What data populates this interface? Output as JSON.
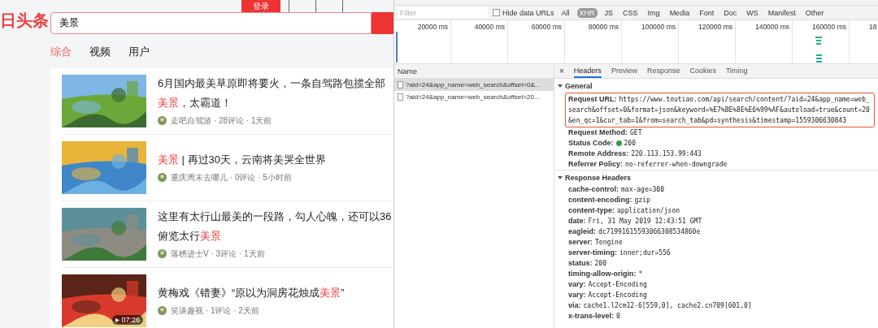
{
  "site": {
    "logo": "日头条",
    "login": "登录",
    "search": {
      "value": "美景"
    },
    "tabs": [
      {
        "label": "综合",
        "selected": true
      },
      {
        "label": "视频",
        "selected": false
      },
      {
        "label": "用户",
        "selected": false
      }
    ],
    "results": [
      {
        "lines": [
          [
            {
              "text": "6月国内最美草原即将要火，一条自驾路包揽全部",
              "highlight": false
            }
          ],
          [
            {
              "text": "美景",
              "highlight": true
            },
            {
              "text": "，太霸道！",
              "highlight": false
            }
          ]
        ],
        "meta": "走吧自驾游 · 28评论 · 1天前",
        "thumb": {
          "kind": "picture"
        }
      },
      {
        "lines": [
          [
            {
              "text": "美景",
              "highlight": true
            },
            {
              "text": " | 再过30天，云南将美哭全世界",
              "highlight": false
            }
          ]
        ],
        "meta": "重庆周末去哪儿 · 0评论 · 5小时前",
        "thumb": {
          "kind": "picture"
        }
      },
      {
        "lines": [
          [
            {
              "text": "这里有太行山最美的一段路，勾人心魄，还可以36",
              "highlight": false
            }
          ],
          [
            {
              "text": "俯览太行",
              "highlight": false
            },
            {
              "text": "美景",
              "highlight": true
            }
          ]
        ],
        "meta": "落榜进士V · 3评论 · 1天前",
        "thumb": {
          "kind": "picture"
        }
      },
      {
        "lines": [
          [
            {
              "text": "黄梅戏《错妻》“原以为洞房花烛成",
              "highlight": false
            },
            {
              "text": "美景",
              "highlight": true
            },
            {
              "text": "”",
              "highlight": false
            }
          ]
        ],
        "meta": "笑谈趣视 · 1评论 · 2天前",
        "thumb": {
          "kind": "picture"
        },
        "duration": "07:26"
      }
    ]
  },
  "devtools": {
    "filter": {
      "placeholder": "Filter"
    },
    "hide_data_urls": {
      "label": "Hide data URLs",
      "checked": false
    },
    "types": [
      {
        "label": "All",
        "selected": false
      },
      {
        "label": "XHR",
        "selected": true
      },
      {
        "label": "JS",
        "selected": false
      },
      {
        "label": "CSS",
        "selected": false
      },
      {
        "label": "Img",
        "selected": false
      },
      {
        "label": "Media",
        "selected": false
      },
      {
        "label": "Font",
        "selected": false
      },
      {
        "label": "Doc",
        "selected": false
      },
      {
        "label": "WS",
        "selected": false
      },
      {
        "label": "Manifest",
        "selected": false
      },
      {
        "label": "Other",
        "selected": false
      }
    ],
    "timeline_ticks": [
      "20000 ms",
      "40000 ms",
      "60000 ms",
      "80000 ms",
      "100000 ms",
      "120000 ms",
      "140000 ms",
      "160000 ms",
      "18"
    ],
    "name_header": "Name",
    "requests": [
      {
        "name": "?aid=24&app_name=web_search&offset=0&...",
        "selected": true
      },
      {
        "name": "?aid=24&app_name=web_search&offset=20...",
        "selected": false
      }
    ],
    "close": "×",
    "detail_tabs": [
      {
        "label": "Headers",
        "selected": true
      },
      {
        "label": "Preview",
        "selected": false
      },
      {
        "label": "Response",
        "selected": false
      },
      {
        "label": "Cookies",
        "selected": false
      },
      {
        "label": "Timing",
        "selected": false
      }
    ],
    "sections": [
      {
        "title": "General",
        "headers": [
          {
            "key": "Request URL:",
            "value": "https://www.toutiao.com/api/search/content/?aid=24&app_name=web_search&offset=0&format=json&keyword=%E7%BE%8E%E6%99%AF&autoload=true&count=20&en_qc=1&cur_tab=1&from=search_tab&pd=synthesis&timestamp=1559306630843",
            "highlighted": true
          },
          {
            "key": "Request Method:",
            "value": "GET",
            "highlighted": false
          },
          {
            "key": "Status Code:",
            "value": "200",
            "color": "#2ea043",
            "highlighted": false
          },
          {
            "key": "Remote Address:",
            "value": "220.113.153.99:443",
            "highlighted": false
          },
          {
            "key": "Referrer Policy:",
            "value": "no-referrer-when-downgrade",
            "highlighted": false
          }
        ]
      },
      {
        "title": "Response Headers",
        "headers": [
          {
            "key": "cache-control:",
            "value": "max-age=300",
            "highlighted": false
          },
          {
            "key": "content-encoding:",
            "value": "gzip",
            "highlighted": false
          },
          {
            "key": "content-type:",
            "value": "application/json",
            "highlighted": false
          },
          {
            "key": "date:",
            "value": "Fri, 31 May 2019 12:43:51 GMT",
            "highlighted": false
          },
          {
            "key": "eagleid:",
            "value": "dc71991615593066308534860e",
            "highlighted": false
          },
          {
            "key": "server:",
            "value": "Tengine",
            "highlighted": false
          },
          {
            "key": "server-timing:",
            "value": "inner;dur=556",
            "highlighted": false
          },
          {
            "key": "status:",
            "value": "200",
            "highlighted": false
          },
          {
            "key": "timing-allow-origin:",
            "value": "*",
            "highlighted": false
          },
          {
            "key": "vary:",
            "value": "Accept-Encoding",
            "highlighted": false
          },
          {
            "key": "vary:",
            "value": "Accept-Encoding",
            "highlighted": false
          },
          {
            "key": "via:",
            "value": "cache1.l2cm12-6[559,0], cache2.cn709[601,0]",
            "highlighted": false
          },
          {
            "key": "x-trans-level:",
            "value": "0",
            "highlighted": false
          }
        ]
      }
    ]
  }
}
